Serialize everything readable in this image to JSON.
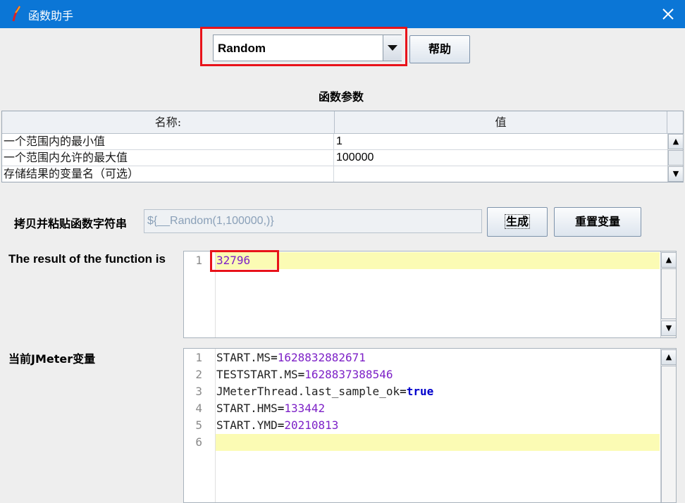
{
  "window": {
    "title": "函数助手",
    "close_icon": "close-icon"
  },
  "colors": {
    "titlebar": "#0b76d6",
    "highlight_box": "#e8131a",
    "line_highlight": "#fbfbb4",
    "number": "#7d21c7",
    "keyword": "#0000cc"
  },
  "function_select": {
    "value": "Random"
  },
  "help_button": "帮助",
  "params": {
    "section_title": "函数参数",
    "columns": [
      "名称:",
      "值"
    ],
    "rows": [
      {
        "name": "一个范围内的最小值",
        "value": "1"
      },
      {
        "name": "一个范围内允许的最大值",
        "value": "100000"
      },
      {
        "name": "存储结果的变量名（可选）",
        "value": ""
      }
    ]
  },
  "function_string": {
    "label": "拷贝并粘贴函数字符串",
    "value": "${__Random(1,100000,)}"
  },
  "generate_button": "生成",
  "reset_button": "重置变量",
  "result": {
    "label": "The result of the function is",
    "lines": [
      {
        "no": "1",
        "text": "32796"
      }
    ]
  },
  "variables": {
    "label": "当前JMeter变量",
    "lines": [
      {
        "no": "1",
        "key": "START.MS",
        "value": "1628832882671"
      },
      {
        "no": "2",
        "key": "TESTSTART.MS",
        "value": "1628837388546"
      },
      {
        "no": "3",
        "key": "JMeterThread.last_sample_ok",
        "value": "true"
      },
      {
        "no": "4",
        "key": "START.HMS",
        "value": "133442"
      },
      {
        "no": "5",
        "key": "START.YMD",
        "value": "20210813"
      },
      {
        "no": "6",
        "key": "",
        "value": ""
      }
    ]
  }
}
